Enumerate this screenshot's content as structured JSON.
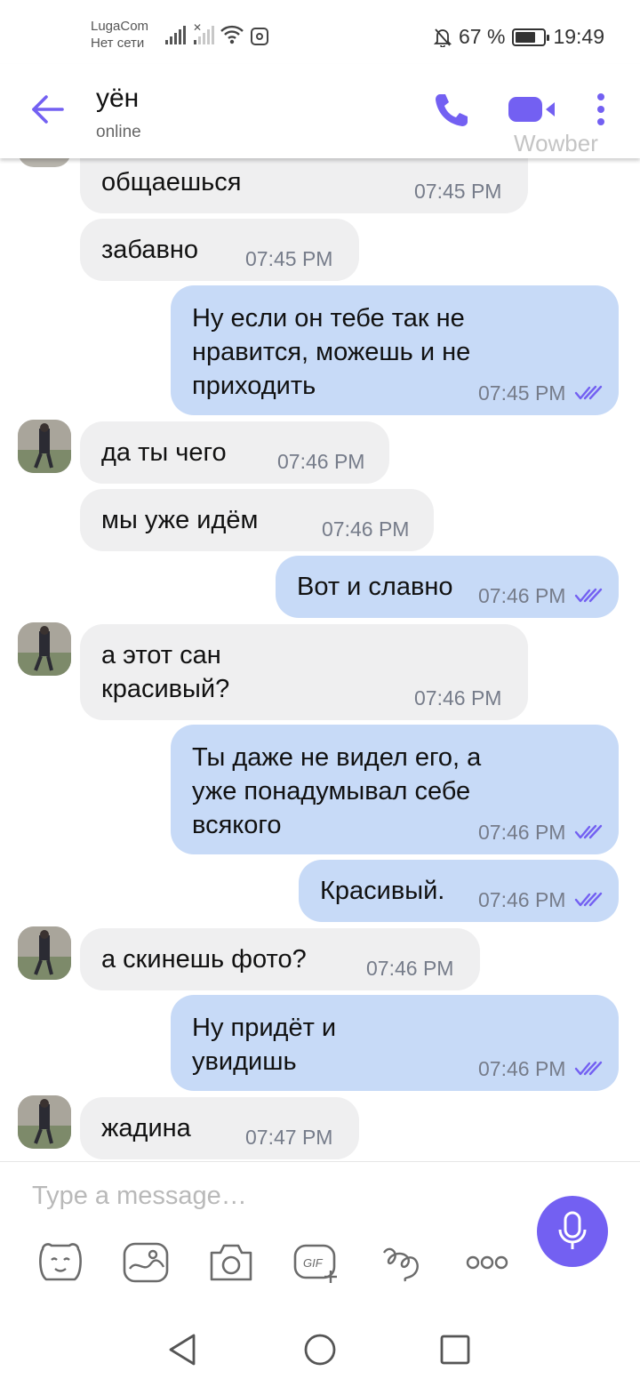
{
  "status_bar": {
    "carrier": "LugaCom",
    "network_status": "Нет сети",
    "battery": "67 %",
    "time": "19:49"
  },
  "header": {
    "contact_name": "уён",
    "contact_status": "online",
    "watermark": "Wowber"
  },
  "colors": {
    "accent": "#7360f2",
    "incoming_bubble": "#efeff0",
    "outgoing_bubble": "#c7daf7",
    "time_text": "#767c8a"
  },
  "messages": [
    {
      "dir": "in",
      "text": "общаешься",
      "time": "07:45 PM",
      "avatar": false
    },
    {
      "dir": "in",
      "text": "забавно",
      "time": "07:45 PM",
      "avatar": false
    },
    {
      "dir": "out",
      "text": "Ну если он тебе так не\nнравится, можешь и не\nприходить",
      "time": "07:45 PM",
      "read": true
    },
    {
      "dir": "in",
      "text": "да ты чего",
      "time": "07:46 PM",
      "avatar": true
    },
    {
      "dir": "in",
      "text": "мы уже идём",
      "time": "07:46 PM",
      "avatar": false
    },
    {
      "dir": "out",
      "text": "Вот и славно",
      "time": "07:46 PM",
      "read": true
    },
    {
      "dir": "in",
      "text": "а этот сан\nкрасивый?",
      "time": "07:46 PM",
      "avatar": true
    },
    {
      "dir": "out",
      "text": "Ты даже не видел его, а\nуже понадумывал себе\nвсякого",
      "time": "07:46 PM",
      "read": true
    },
    {
      "dir": "out",
      "text": "Красивый.",
      "time": "07:46 PM",
      "read": true
    },
    {
      "dir": "in",
      "text": "а скинешь фото?",
      "time": "07:46 PM",
      "avatar": true
    },
    {
      "dir": "out",
      "text": "Ну придёт и\nувидишь",
      "time": "07:46 PM",
      "read": true
    },
    {
      "dir": "in",
      "text": "жадина",
      "time": "07:47 PM",
      "avatar": true
    }
  ],
  "composer": {
    "placeholder": "Type a message…",
    "tools": [
      "sticker-icon",
      "doodle-icon",
      "camera-icon",
      "gif-icon",
      "brush-icon",
      "more-options-icon"
    ]
  },
  "nav": [
    "back-triangle-icon",
    "home-circle-icon",
    "recents-square-icon"
  ]
}
